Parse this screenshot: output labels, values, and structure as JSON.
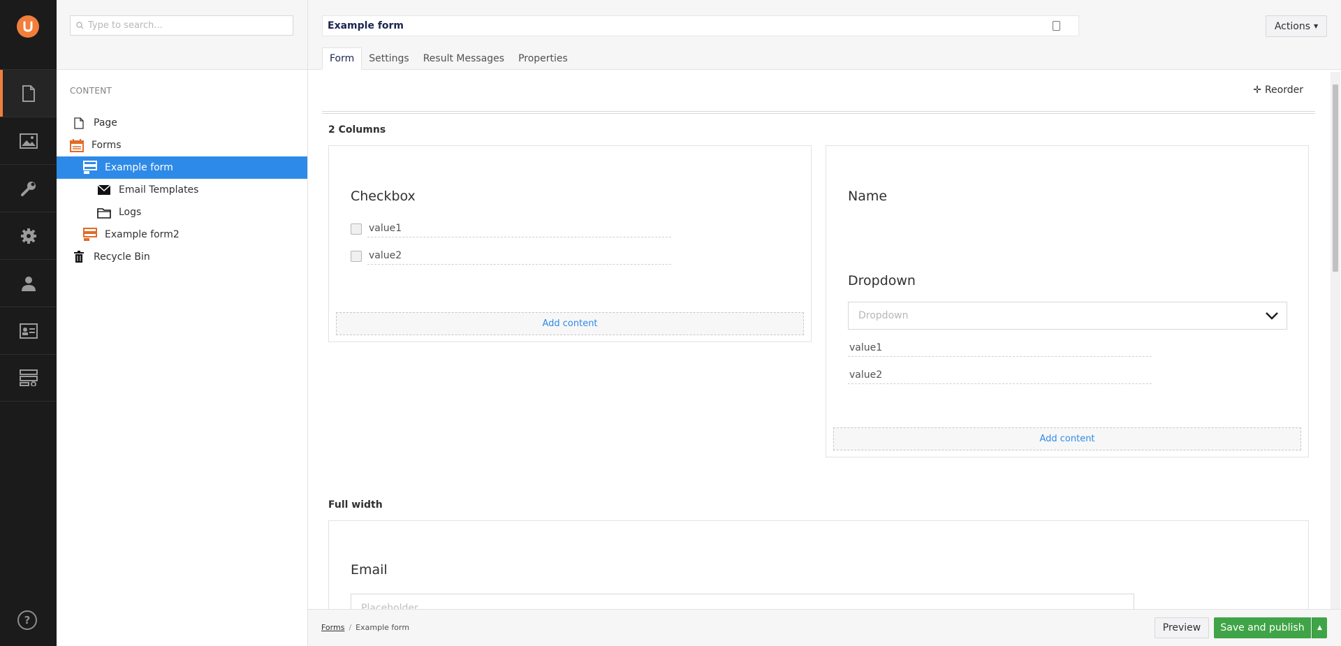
{
  "rail": {
    "logo_icon": "umbraco-logo",
    "sections": [
      {
        "name": "content",
        "icon": "document-icon",
        "active": true
      },
      {
        "name": "media",
        "icon": "image-icon",
        "active": false
      },
      {
        "name": "settings",
        "icon": "wrench-icon",
        "active": false
      },
      {
        "name": "packages",
        "icon": "gear-icon",
        "active": false
      },
      {
        "name": "users",
        "icon": "user-icon",
        "active": false
      },
      {
        "name": "members",
        "icon": "id-card-icon",
        "active": false
      },
      {
        "name": "forms",
        "icon": "forms-icon",
        "active": false
      }
    ],
    "help_label": "?"
  },
  "tree": {
    "search_placeholder": "Type to search...",
    "heading": "Content",
    "items": [
      {
        "label": "Page",
        "icon": "document-icon"
      },
      {
        "label": "Forms",
        "icon": "forms-calendar-icon"
      },
      {
        "label": "Example form",
        "icon": "form-icon",
        "active": true
      },
      {
        "label": "Email Templates",
        "icon": "envelope-icon"
      },
      {
        "label": "Logs",
        "icon": "folder-icon"
      },
      {
        "label": "Example form2",
        "icon": "form-icon"
      },
      {
        "label": "Recycle Bin",
        "icon": "trash-icon"
      }
    ]
  },
  "header": {
    "name_value": "Example form",
    "actions_label": "Actions",
    "tabs": [
      "Form",
      "Settings",
      "Result Messages",
      "Properties"
    ],
    "active_tab": "Form"
  },
  "main": {
    "reorder_label": "Reorder",
    "rows": [
      {
        "label": "2 Columns",
        "left": {
          "field_label": "Checkbox",
          "options": [
            "value1",
            "value2"
          ],
          "add_content": "Add content"
        },
        "right": {
          "name_label": "Name",
          "dropdown_label": "Dropdown",
          "dropdown_placeholder": "Dropdown",
          "options": [
            "value1",
            "value2"
          ],
          "add_content": "Add content"
        }
      },
      {
        "label": "Full width",
        "field_label": "Email",
        "placeholder": "Placeholder"
      }
    ]
  },
  "footer": {
    "breadcrumb": [
      "Forms",
      "Example form"
    ],
    "preview_label": "Preview",
    "publish_label": "Save and publish"
  },
  "colors": {
    "accent_orange": "#f07f3c",
    "selection_blue": "#2e8ae8",
    "publish_green": "#3fa447",
    "rail_bg": "#1b1b1b"
  }
}
